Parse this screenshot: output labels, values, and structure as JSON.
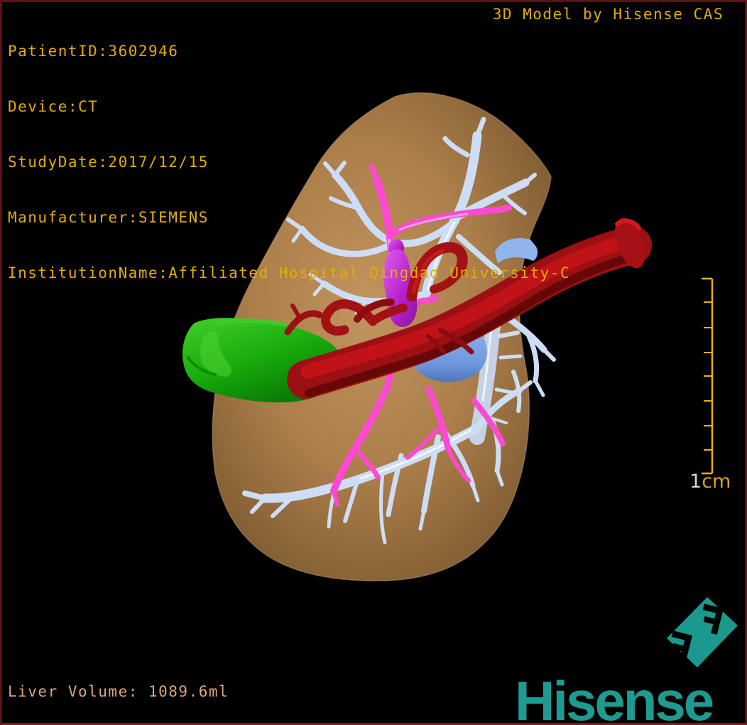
{
  "overlay": {
    "lines": [
      "PatientID:3602946",
      "Device:CT",
      "StudyDate:2017/12/15",
      "Manufacturer:SIEMENS",
      "InstitutionName:Affiliated Hospital Qingdao University-C"
    ],
    "watermark": "3D Model by Hisense CAS",
    "volume": "Liver Volume: 1089.6ml"
  },
  "scale_bar": {
    "number": "1",
    "unit": "cm",
    "intervals": 8
  },
  "branding": {
    "wordmark": "Hisense",
    "icon": "hisense-cas-diamond-icon"
  },
  "model": {
    "structures": [
      {
        "name": "liver",
        "color": "#b08550"
      },
      {
        "name": "hepatic-veins",
        "color": "#cdddf6"
      },
      {
        "name": "portal-branches",
        "color": "#ff49d0"
      },
      {
        "name": "artery-ivc-red",
        "color": "#9c0f12"
      },
      {
        "name": "gallbladder",
        "color": "#1eb30d"
      },
      {
        "name": "portal-trunk-blue",
        "color": "#7ba3e2"
      },
      {
        "name": "lesion-purple",
        "color": "#c32fd3"
      }
    ]
  },
  "colors": {
    "overlay_text": "#e3ac07",
    "volume_text": "#d9a87c",
    "scale_bar": "#e8b402",
    "brand_teal": "#1d9b90",
    "border": "#5c1010",
    "background": "#000000"
  }
}
